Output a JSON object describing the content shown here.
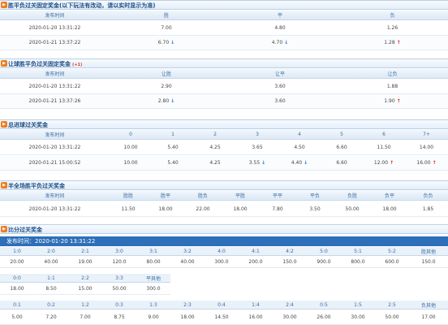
{
  "sec1": {
    "title": "胜平负过关固定奖金",
    "note": "(以下玩法有改动，请以实时显示为准)",
    "headers": [
      "发布时间",
      "胜",
      "平",
      "负"
    ],
    "rows": [
      {
        "time": "2020-01-20 13:31:22",
        "v": [
          "7.00",
          "4.80",
          "1.26"
        ],
        "arrows": [
          "",
          "",
          ""
        ]
      },
      {
        "time": "2020-01-21 13:37:22",
        "v": [
          "6.70",
          "4.70",
          "1.28"
        ],
        "arrows": [
          "down",
          "down",
          "up"
        ]
      }
    ]
  },
  "sec2": {
    "title": "让球胜平负过关固定奖金",
    "tag": "(+1)",
    "headers": [
      "发布时间",
      "让胜",
      "让平",
      "让负"
    ],
    "rows": [
      {
        "time": "2020-01-20 13:31:22",
        "v": [
          "2.90",
          "3.60",
          "1.88"
        ],
        "arrows": [
          "",
          "",
          ""
        ]
      },
      {
        "time": "2020-01-21 13:37:26",
        "v": [
          "2.80",
          "3.60",
          "1.90"
        ],
        "arrows": [
          "down",
          "",
          "up"
        ]
      }
    ]
  },
  "sec3": {
    "title": "总进球过关奖金",
    "headers": [
      "发布时间",
      "0",
      "1",
      "2",
      "3",
      "4",
      "5",
      "6",
      "7+"
    ],
    "rows": [
      {
        "time": "2020-01-20 13:31:22",
        "v": [
          "10.00",
          "5.40",
          "4.25",
          "3.65",
          "4.50",
          "6.60",
          "11.50",
          "14.00"
        ],
        "arrows": [
          "",
          "",
          "",
          "",
          "",
          "",
          "",
          ""
        ]
      },
      {
        "time": "2020-01-21 15:00:52",
        "v": [
          "10.00",
          "5.40",
          "4.25",
          "3.55",
          "4.40",
          "6.60",
          "12.00",
          "16.00"
        ],
        "arrows": [
          "",
          "",
          "",
          "down",
          "down",
          "",
          "up",
          "up"
        ]
      }
    ]
  },
  "sec4": {
    "title": "半全场胜平负过关奖金",
    "headers": [
      "发布时间",
      "胜胜",
      "胜平",
      "胜负",
      "平胜",
      "平平",
      "平负",
      "负胜",
      "负平",
      "负负"
    ],
    "rows": [
      {
        "time": "2020-01-20 13:31:22",
        "v": [
          "11.50",
          "18.00",
          "22.00",
          "18.00",
          "7.80",
          "3.50",
          "50.00",
          "18.00",
          "1.85"
        ]
      }
    ]
  },
  "sec5": {
    "title": "比分过关奖金",
    "publish_label": "发布时间：2020-01-20 13:31:22",
    "row1_headers": [
      "1:0",
      "2:0",
      "2:1",
      "3:0",
      "3:1",
      "3:2",
      "4:0",
      "4:1",
      "4:2",
      "5:0",
      "5:1",
      "5:2",
      "胜其他"
    ],
    "row1_values": [
      "20.00",
      "40.00",
      "19.00",
      "120.0",
      "80.00",
      "40.00",
      "300.0",
      "200.0",
      "150.0",
      "900.0",
      "800.0",
      "600.0",
      "150.0"
    ],
    "row2_headers": [
      "0:0",
      "1:1",
      "2:2",
      "3:3",
      "平其他"
    ],
    "row2_values": [
      "18.00",
      "8.50",
      "15.00",
      "50.00",
      "300.0"
    ],
    "row3_headers": [
      "0:1",
      "0:2",
      "1:2",
      "0:3",
      "1:3",
      "2:3",
      "0:4",
      "1:4",
      "2:4",
      "0:5",
      "1:5",
      "2:5",
      "负其他"
    ],
    "row3_values": [
      "5.00",
      "7.20",
      "7.00",
      "8.75",
      "9.00",
      "18.00",
      "14.50",
      "16.00",
      "30.00",
      "26.00",
      "30.00",
      "50.00",
      "17.00"
    ]
  }
}
